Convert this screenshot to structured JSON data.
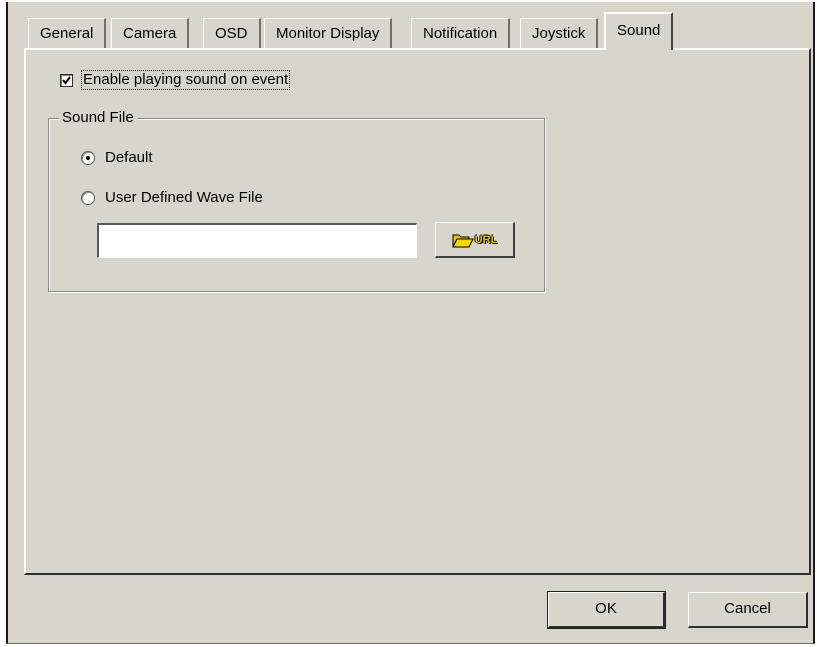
{
  "tabs": [
    {
      "label": "General"
    },
    {
      "label": "Camera"
    },
    {
      "label": "OSD"
    },
    {
      "label": "Monitor Display"
    },
    {
      "label": "Notification"
    },
    {
      "label": "Joystick"
    },
    {
      "label": "Sound",
      "active": true
    }
  ],
  "sound": {
    "enable_label": "Enable playing sound on event",
    "enable_checked": true,
    "group_title": "Sound File",
    "option_default": "Default",
    "option_user": "User Defined Wave File",
    "selected_option": "Default",
    "wave_file_value": "",
    "browse_icon": "folder-open-icon",
    "browse_label": "URL"
  },
  "footer": {
    "ok_label": "OK",
    "cancel_label": "Cancel"
  },
  "colors": {
    "background": "#d8d5cd",
    "icon_yellow": "#e8c400"
  }
}
